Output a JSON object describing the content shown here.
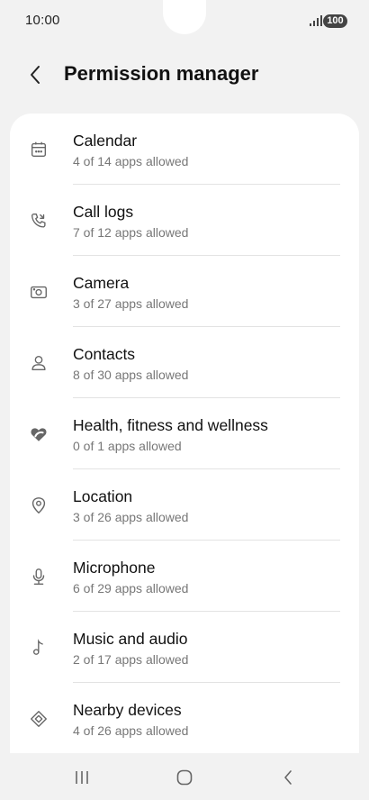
{
  "status_bar": {
    "time": "10:00",
    "battery": "100",
    "icons": [
      "signal-icon",
      "battery-icon"
    ]
  },
  "header": {
    "back_icon": "chevron-left-icon",
    "title": "Permission manager"
  },
  "permissions": [
    {
      "icon": "calendar-icon",
      "title": "Calendar",
      "subtitle": "4 of 14 apps allowed"
    },
    {
      "icon": "call-log-icon",
      "title": "Call logs",
      "subtitle": "7 of 12 apps allowed"
    },
    {
      "icon": "camera-icon",
      "title": "Camera",
      "subtitle": "3 of 27 apps allowed"
    },
    {
      "icon": "contacts-icon",
      "title": "Contacts",
      "subtitle": "8 of 30 apps allowed"
    },
    {
      "icon": "health-icon",
      "title": "Health, fitness and wellness",
      "subtitle": "0 of 1 apps allowed"
    },
    {
      "icon": "location-icon",
      "title": "Location",
      "subtitle": "3 of 26 apps allowed"
    },
    {
      "icon": "microphone-icon",
      "title": "Microphone",
      "subtitle": "6 of 29 apps allowed"
    },
    {
      "icon": "music-icon",
      "title": "Music and audio",
      "subtitle": "2 of 17 apps allowed"
    },
    {
      "icon": "nearby-devices-icon",
      "title": "Nearby devices",
      "subtitle": "4 of 26 apps allowed"
    }
  ],
  "nav_bar": {
    "icons": [
      "recent-apps-icon",
      "home-icon",
      "back-icon"
    ]
  },
  "colors": {
    "background": "#f2f2f2",
    "card": "#ffffff",
    "subtitle": "#777777",
    "icon": "#666666"
  }
}
